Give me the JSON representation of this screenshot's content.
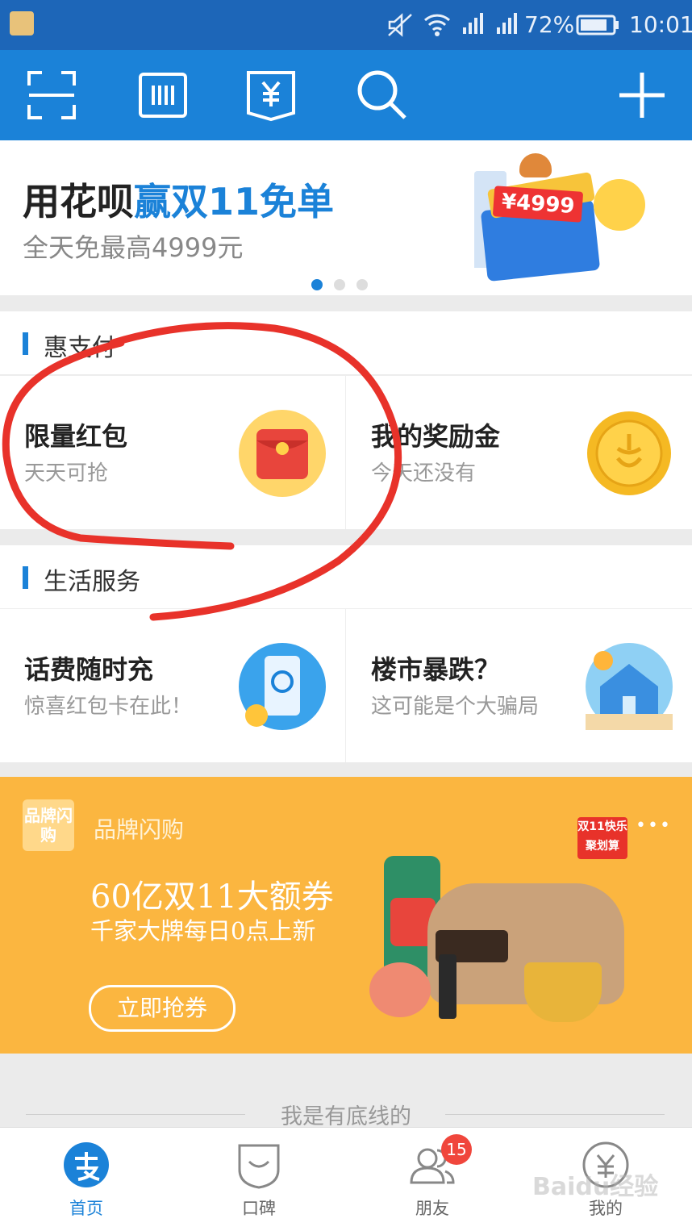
{
  "status_bar": {
    "battery_percent": "72%",
    "time": "10:01"
  },
  "top_bar": {
    "icons": [
      "scan-icon",
      "barcode-icon",
      "payment-code-icon",
      "search-icon",
      "add-icon"
    ]
  },
  "banner": {
    "title_part1": "用花呗",
    "title_part2": "赢双11免单",
    "subtitle": "全天免最高4999元",
    "price_tag": "¥4999",
    "page_count": 3,
    "active_page": 1
  },
  "section_discount": {
    "title": "惠支付",
    "cards": [
      {
        "title": "限量红包",
        "subtitle": "天天可抢",
        "icon": "red-envelope-icon"
      },
      {
        "title": "我的奖励金",
        "subtitle": "今天还没有",
        "icon": "gold-coin-icon"
      }
    ]
  },
  "section_life": {
    "title": "生活服务",
    "cards": [
      {
        "title": "话费随时充",
        "subtitle": "惊喜红包卡在此！",
        "icon": "phone-recharge-icon"
      },
      {
        "title": "楼市暴跌？",
        "subtitle": "这可能是个大骗局",
        "icon": "house-icon"
      }
    ]
  },
  "promo": {
    "badge": "品牌闪购",
    "label": "品牌闪购",
    "headline": "60亿双11大额券",
    "subline": "千家大牌每日0点上新",
    "button": "立即抢券",
    "tag_top": "双11快乐",
    "tag_bottom": "聚划算",
    "more": "•••"
  },
  "footer_text": "我是有底线的",
  "bottom_nav": [
    {
      "label": "首页",
      "icon": "alipay-home-icon",
      "active": true
    },
    {
      "label": "口碑",
      "icon": "koubei-icon",
      "active": false
    },
    {
      "label": "朋友",
      "icon": "friends-icon",
      "active": false,
      "badge": "15"
    },
    {
      "label": "我的",
      "icon": "profile-icon",
      "active": false
    }
  ],
  "colors": {
    "brand_blue": "#1b82d8",
    "status_blue": "#1d66b8",
    "promo_orange": "#fbb640",
    "badge_red": "#f0463c"
  }
}
